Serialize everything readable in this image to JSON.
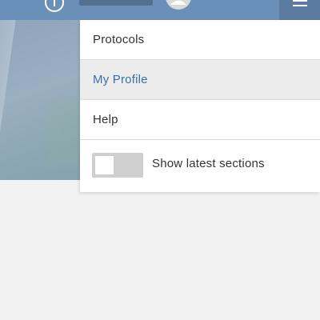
{
  "header": {
    "icons": [
      "info-icon",
      "avatar-icon",
      "hamburger-menu-icon"
    ],
    "colors": {
      "bar": "#6a8fb8",
      "menu_button": "#5b7aa0"
    }
  },
  "menu": {
    "items": [
      {
        "label": "Protocols",
        "active": false
      },
      {
        "label": "My Profile",
        "active": true
      },
      {
        "label": "Help",
        "active": false
      }
    ],
    "toggle": {
      "label": "Show latest sections",
      "enabled": false
    },
    "colors": {
      "active_text": "#3a6fa5",
      "active_bg": "#ececec"
    }
  }
}
